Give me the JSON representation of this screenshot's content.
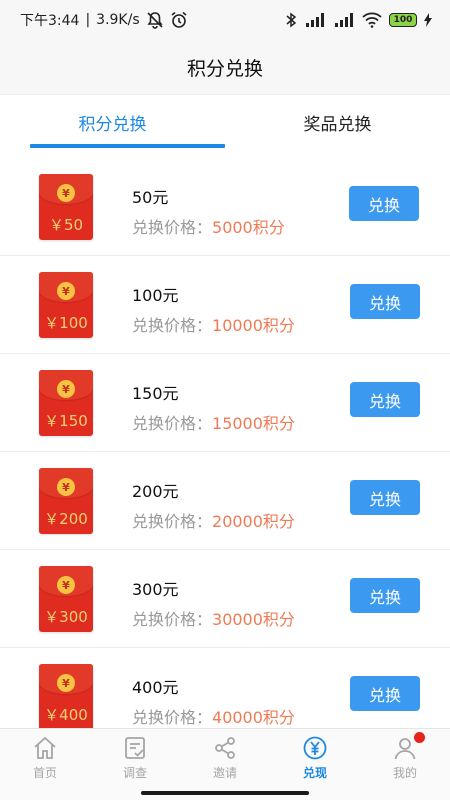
{
  "status_bar": {
    "time": "下午3:44",
    "separator": "|",
    "speed": "3.9K/s",
    "battery": "100"
  },
  "header": {
    "title": "积分兑换"
  },
  "tabs": [
    {
      "label": "积分兑换",
      "active": true
    },
    {
      "label": "奖品兑换",
      "active": false
    }
  ],
  "items": [
    {
      "badge": "￥50",
      "name": "50元",
      "price_label": "兑换价格：",
      "price_value": "5000积分",
      "button": "兑换"
    },
    {
      "badge": "￥100",
      "name": "100元",
      "price_label": "兑换价格：",
      "price_value": "10000积分",
      "button": "兑换"
    },
    {
      "badge": "￥150",
      "name": "150元",
      "price_label": "兑换价格：",
      "price_value": "15000积分",
      "button": "兑换"
    },
    {
      "badge": "￥200",
      "name": "200元",
      "price_label": "兑换价格：",
      "price_value": "20000积分",
      "button": "兑换"
    },
    {
      "badge": "￥300",
      "name": "300元",
      "price_label": "兑换价格：",
      "price_value": "30000积分",
      "button": "兑换"
    },
    {
      "badge": "￥400",
      "name": "400元",
      "price_label": "兑换价格：",
      "price_value": "40000积分",
      "button": "兑换"
    }
  ],
  "coin_symbol": "¥",
  "bottom_nav": [
    {
      "label": "首页",
      "icon": "home-icon",
      "active": false
    },
    {
      "label": "调查",
      "icon": "survey-icon",
      "active": false
    },
    {
      "label": "邀请",
      "icon": "share-icon",
      "active": false
    },
    {
      "label": "兑现",
      "icon": "yen-icon",
      "active": true
    },
    {
      "label": "我的",
      "icon": "user-icon",
      "active": false,
      "badge_dot": true
    }
  ],
  "colors": {
    "accent": "#1e88e5",
    "button": "#3b9af0",
    "points": "#ef7b55",
    "envelope": "#e02b20",
    "notification_dot": "#e8231b"
  }
}
